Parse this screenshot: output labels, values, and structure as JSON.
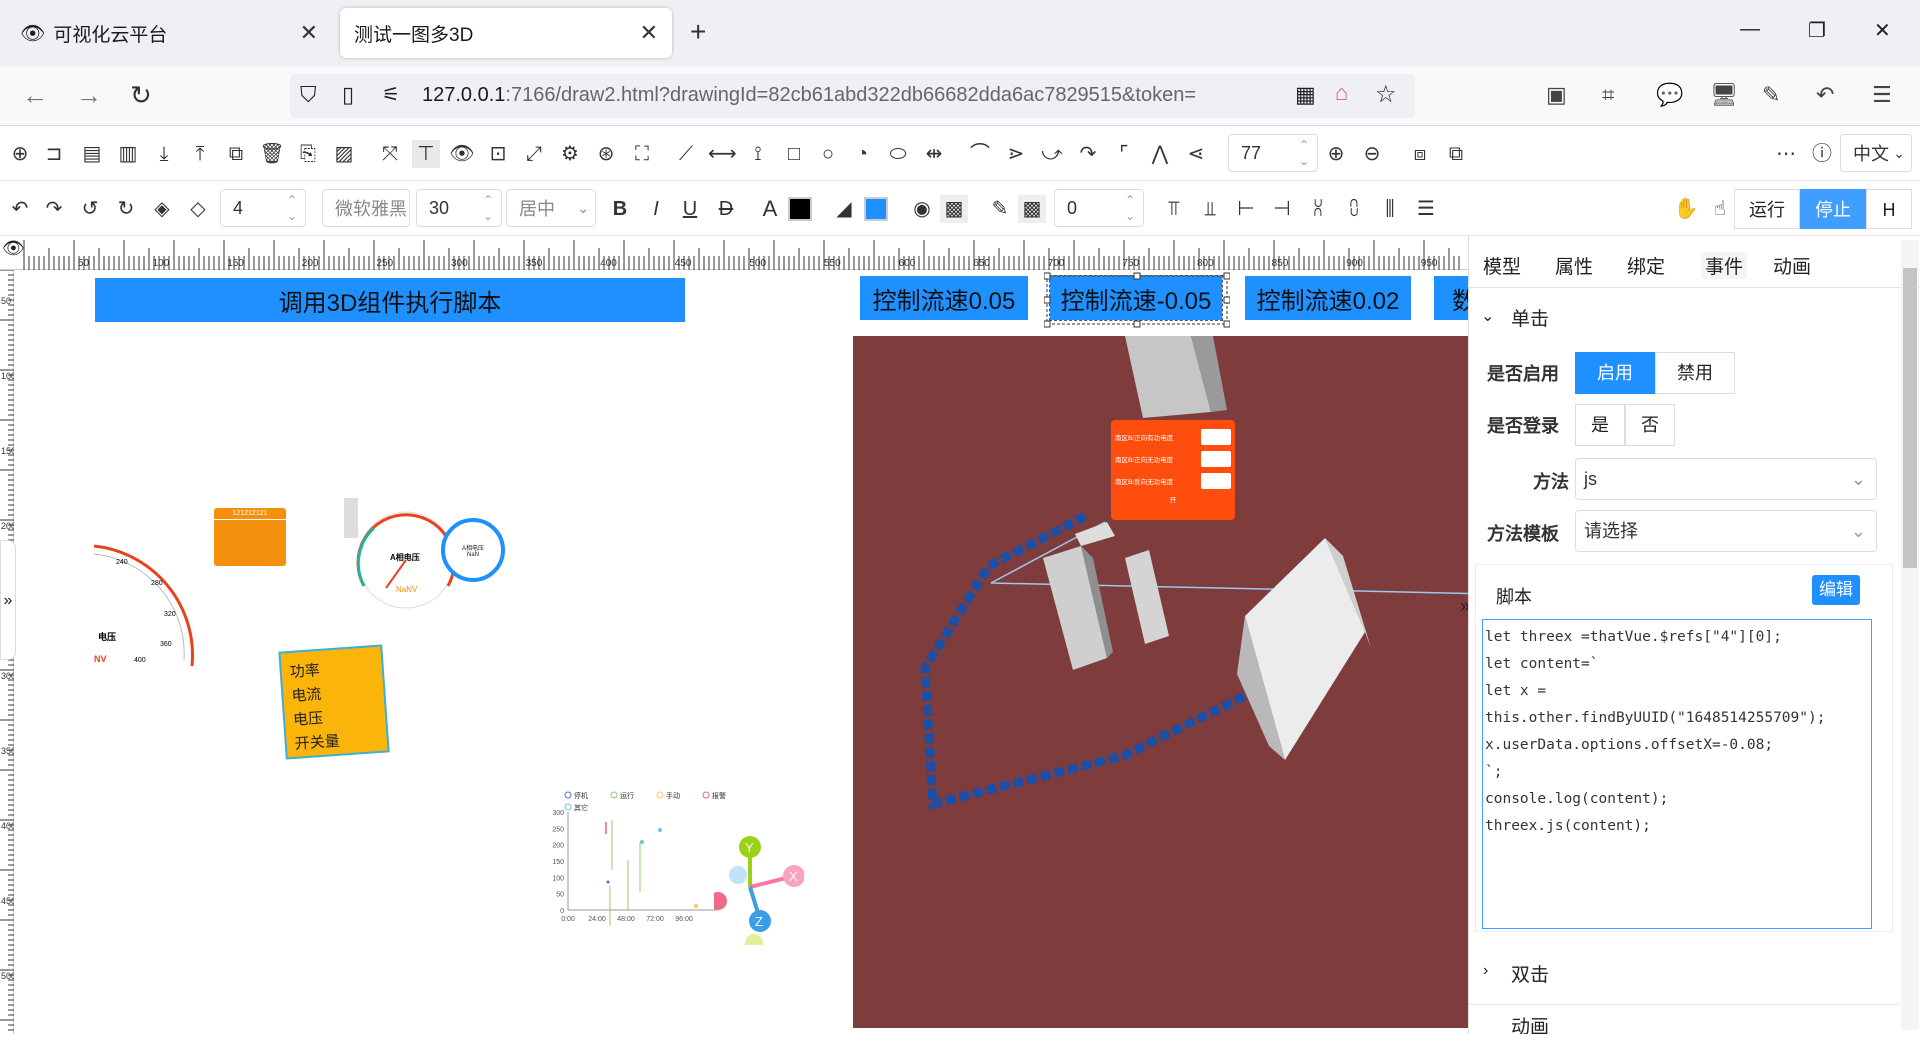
{
  "browser": {
    "tabs": [
      {
        "title": "可视化云平台"
      },
      {
        "title": "测试一图多3D"
      }
    ],
    "url_host": "127.0.0.1",
    "url_rest": ":7166/draw2.html?drawingId=82cb61abd322db66682dda6ac7829515&token="
  },
  "toolbar": {
    "zoom": "77",
    "language": "中文",
    "line_width": "4",
    "font_name": "微软雅黑",
    "font_size": "30",
    "align": "居中",
    "border": "0",
    "bold": "B",
    "italic": "I",
    "underline": "U",
    "strike": "D",
    "text_a": "A",
    "run": "运行",
    "stop": "停止",
    "h": "H"
  },
  "ruler": {
    "top": [
      "50",
      "100",
      "150",
      "200",
      "250",
      "300",
      "350",
      "400",
      "450",
      "500",
      "550",
      "600",
      "650",
      "700",
      "750",
      "800",
      "850",
      "900",
      "950"
    ],
    "left": [
      "50",
      "100",
      "150",
      "200",
      "250",
      "300",
      "350",
      "400",
      "450",
      "500"
    ]
  },
  "canvas": {
    "run_script_btn": "调用3D组件执行脚本",
    "speed_btns": [
      "控制流速0.05",
      "控制流速-0.05",
      "控制流速0.02",
      "数"
    ],
    "gauge1": {
      "unit": "电压",
      "value": "NV",
      "ticks": [
        "240",
        "280",
        "320",
        "360",
        "400"
      ]
    },
    "gauge2": {
      "label": "A相电压",
      "value": "NaNV"
    },
    "circle": {
      "top": "A相电压",
      "bottom": "NaN"
    },
    "orange": {
      "title": "121212121"
    },
    "sticky": [
      "功率",
      "电流",
      "电压",
      "开关量"
    ],
    "chart_legend": [
      "停机",
      "运行",
      "手动",
      "报警",
      "其它"
    ],
    "popup": {
      "rows": [
        "南区B/正向有功电度",
        "南区B/正向无功电度",
        "南区B/反向无功电度"
      ],
      "footer": "开"
    }
  },
  "chart_data": {
    "type": "scatter",
    "x_ticks": [
      "0:00",
      "24:00",
      "48:00",
      "72:00",
      "96:00"
    ],
    "y_ticks": [
      "0",
      "50",
      "100",
      "150",
      "200",
      "250",
      "300"
    ],
    "series": [
      {
        "name": "停机"
      },
      {
        "name": "运行"
      },
      {
        "name": "手动"
      },
      {
        "name": "报警"
      },
      {
        "name": "其它"
      }
    ]
  },
  "axes": {
    "x": "X",
    "y": "Y",
    "z": "Z"
  },
  "panel": {
    "tabs": [
      "模型",
      "属性",
      "绑定",
      "事件",
      "动画"
    ],
    "section_click": "单击",
    "enabled_label": "是否启用",
    "enabled_on": "启用",
    "enabled_off": "禁用",
    "login_label": "是否登录",
    "login_yes": "是",
    "login_no": "否",
    "method_label": "方法",
    "method_value": "js",
    "template_label": "方法模板",
    "template_value": "请选择",
    "script_label": "脚本",
    "edit_btn": "编辑",
    "script": "let threex =thatVue.$refs[\"4\"][0];\nlet content=`\nlet x =\nthis.other.findByUUID(\"1648514255709\");\nx.userData.options.offsetX=-0.08;\n`;\nconsole.log(content);\nthreex.js(content);",
    "section_dbl": "双击",
    "section_next": "动画"
  }
}
